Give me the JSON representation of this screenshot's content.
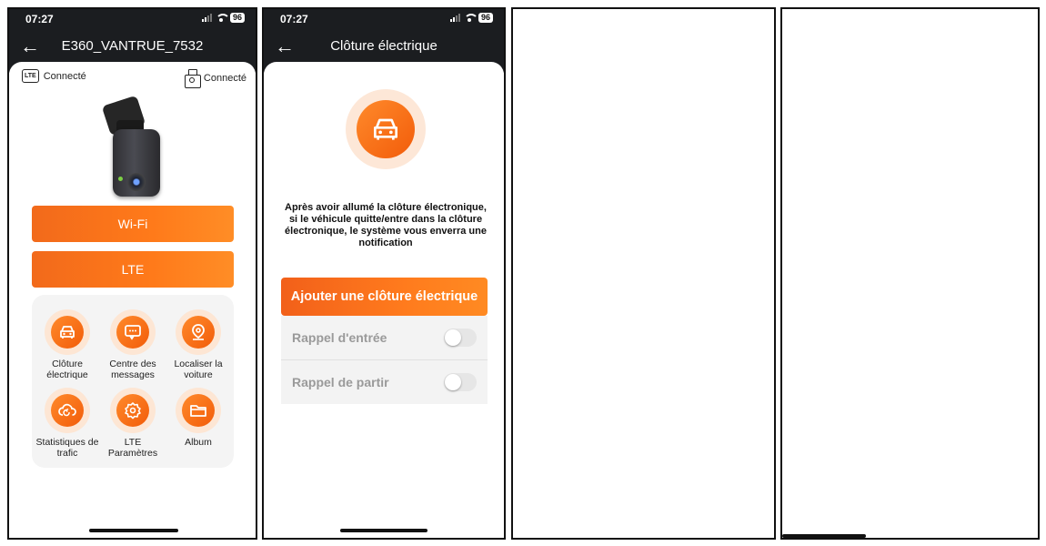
{
  "screen1": {
    "status": {
      "time": "07:27",
      "battery": "96"
    },
    "nav": {
      "title": "E360_VANTRUE_7532",
      "back_icon": "arrow-left-icon"
    },
    "connections": [
      {
        "icon": "lte-icon",
        "badge": "LTE",
        "label": "Connecté"
      },
      {
        "icon": "dashcam-icon",
        "label": "Connecté"
      }
    ],
    "buttons": {
      "wifi": "Wi-Fi",
      "lte": "LTE"
    },
    "tiles": [
      {
        "icon": "car-icon",
        "label": "Clôture électrique"
      },
      {
        "icon": "message-icon",
        "label": "Centre des messages"
      },
      {
        "icon": "location-pin-icon",
        "label": "Localiser la voiture"
      },
      {
        "icon": "cloud-sync-icon",
        "label": "Statistiques de trafic"
      },
      {
        "icon": "settings-gear-icon",
        "label": "LTE Paramètres"
      },
      {
        "icon": "folder-icon",
        "label": "Album"
      }
    ]
  },
  "screen2": {
    "status": {
      "time": "07:27",
      "battery": "96"
    },
    "nav": {
      "title": "Clôture électrique",
      "back_icon": "arrow-left-icon"
    },
    "hero_icon": "car-icon",
    "description": "Après avoir allumé la clôture électronique, si le véhicule quitte/entre dans la clôture électronique, le système vous enverra une notification",
    "add_button": "Ajouter une clôture électrique",
    "options": [
      {
        "label": "Rappel d'entrée",
        "enabled": false
      },
      {
        "label": "Rappel de partir",
        "enabled": false
      }
    ]
  },
  "colors": {
    "accent": "#f26a1b",
    "dark_bar": "#1b1d20",
    "tile_bg": "#f4f4f4"
  }
}
